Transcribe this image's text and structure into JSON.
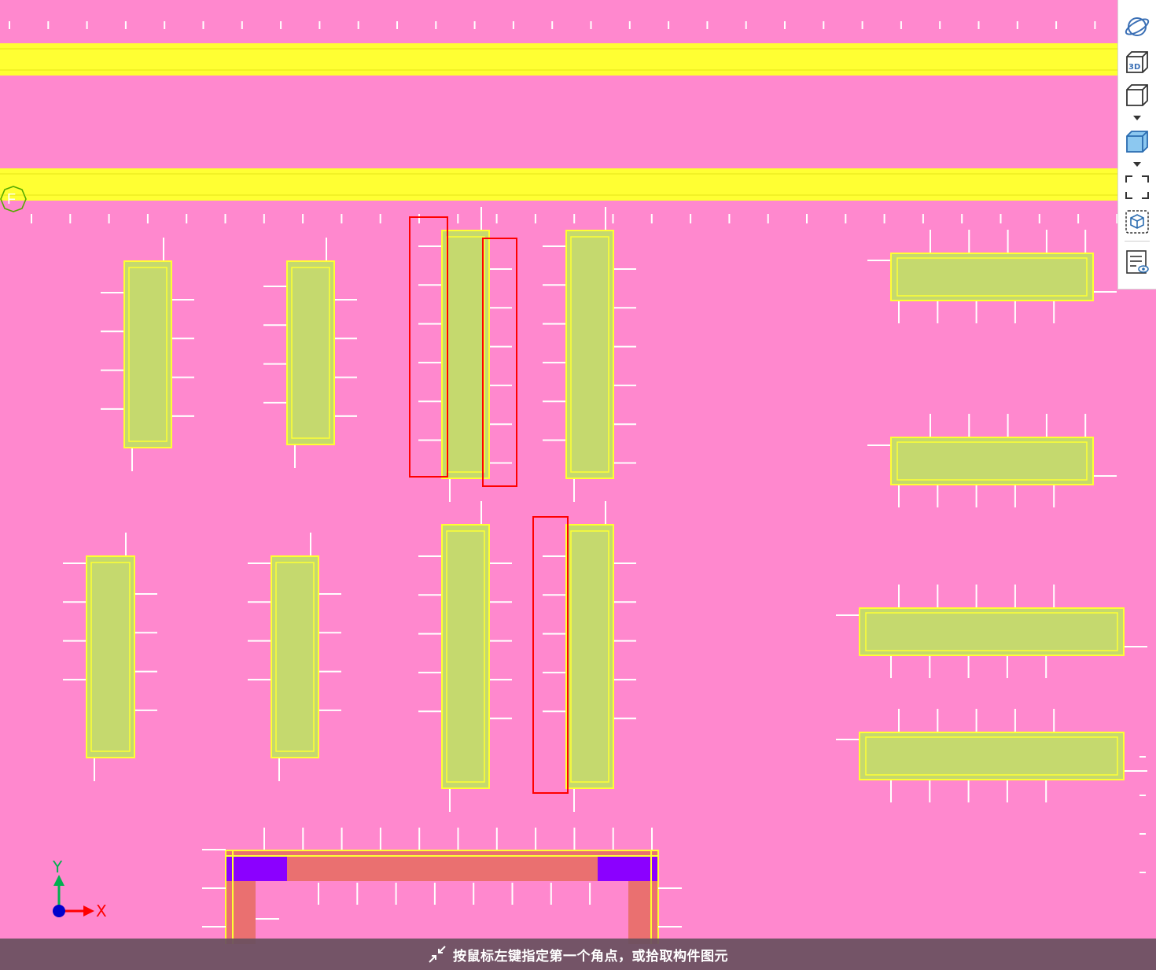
{
  "colors": {
    "background": "#FF88CE",
    "beam_band": "#FFFF33",
    "column_fill": "#C5D96E",
    "column_border": "#FFFF33",
    "rebar_tick": "#FFFFFF",
    "selection_box": "#FF0000",
    "wall_fill": "#EA7070",
    "corner_fill": "#8B00FF"
  },
  "grid": {
    "marker_label": "F"
  },
  "axis": {
    "x_label": "X",
    "y_label": "Y"
  },
  "toolbar": {
    "buttons": [
      {
        "name": "orbit-view-button",
        "icon": "orbit-icon"
      },
      {
        "name": "view-3d-button",
        "icon": "cube-3d-icon"
      },
      {
        "name": "wireframe-view-button",
        "icon": "wireframe-cube-icon",
        "has_dropdown": true
      },
      {
        "name": "shaded-view-button",
        "icon": "shaded-cube-icon",
        "has_dropdown": true
      },
      {
        "name": "fit-view-button",
        "icon": "fit-frame-icon"
      },
      {
        "name": "partial-3d-button",
        "icon": "dashed-cube-icon"
      },
      {
        "name": "display-settings-button",
        "icon": "list-eye-icon"
      }
    ]
  },
  "status": {
    "message": "按鼠标左键指定第一个角点，或拾取构件图元"
  }
}
